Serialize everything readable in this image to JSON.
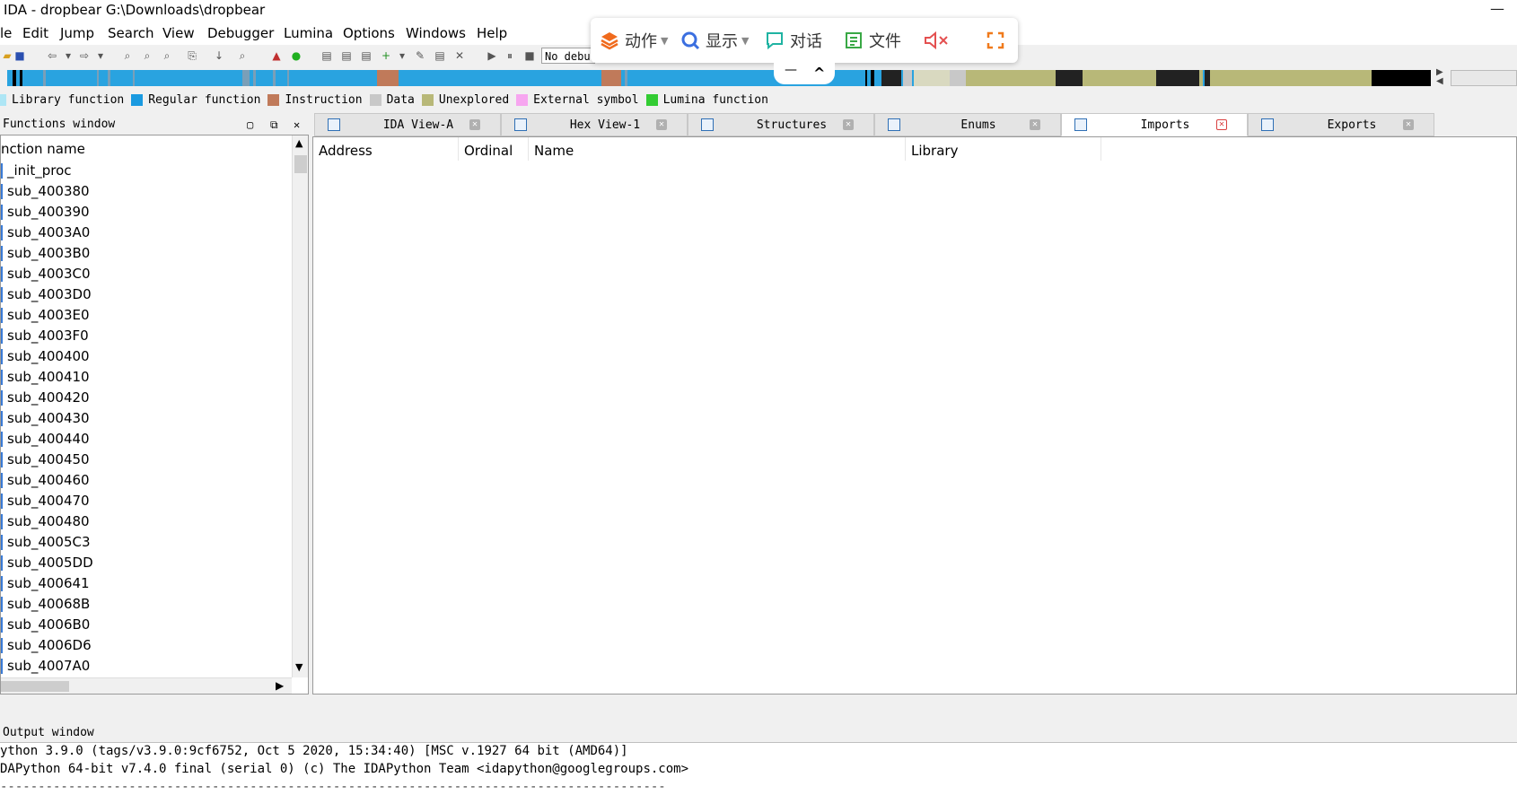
{
  "window": {
    "title": "IDA - dropbear G:\\Downloads\\dropbear",
    "minimize_symbol": "—"
  },
  "menu": [
    "le",
    "Edit",
    "Jump",
    "Search",
    "View",
    "Debugger",
    "Lumina",
    "Options",
    "Windows",
    "Help"
  ],
  "toolbar": {
    "debugger_select_value": "No debu"
  },
  "float_toolbar": {
    "action_label": "动作",
    "display_label": "显示",
    "chat_label": "对话",
    "file_label": "文件",
    "collapse_minus": "—",
    "collapse_up": "^",
    "colors": {
      "action": "#f06a1c",
      "display": "#3b6fe0",
      "chat": "#1fb3a2",
      "file": "#39a845",
      "mute": "#e45050",
      "fullscreen": "#f07a1c"
    }
  },
  "legend": [
    {
      "label": "Library function",
      "color": "#aee6f5"
    },
    {
      "label": "Regular function",
      "color": "#1a9ae0"
    },
    {
      "label": "Instruction",
      "color": "#c07a5a"
    },
    {
      "label": "Data",
      "color": "#c8c8c8"
    },
    {
      "label": "Unexplored",
      "color": "#b8b878"
    },
    {
      "label": "External symbol",
      "color": "#f7a6f0"
    },
    {
      "label": "Lumina function",
      "color": "#33cc33"
    }
  ],
  "functions_window": {
    "title": "Functions window",
    "column": "nction name",
    "items": [
      "_init_proc",
      "sub_400380",
      "sub_400390",
      "sub_4003A0",
      "sub_4003B0",
      "sub_4003C0",
      "sub_4003D0",
      "sub_4003E0",
      "sub_4003F0",
      "sub_400400",
      "sub_400410",
      "sub_400420",
      "sub_400430",
      "sub_400440",
      "sub_400450",
      "sub_400460",
      "sub_400470",
      "sub_400480",
      "sub_4005C3",
      "sub_4005DD",
      "sub_400641",
      "sub_40068B",
      "sub_4006B0",
      "sub_4006D6",
      "sub_4007A0"
    ]
  },
  "tabs": [
    {
      "label": "IDA View-A",
      "active": false
    },
    {
      "label": "Hex View-1",
      "active": false
    },
    {
      "label": "Structures",
      "active": false
    },
    {
      "label": "Enums",
      "active": false
    },
    {
      "label": "Imports",
      "active": true
    },
    {
      "label": "Exports",
      "active": false
    }
  ],
  "imports": {
    "columns": [
      "Address",
      "Ordinal",
      "Name",
      "Library"
    ]
  },
  "output_window": {
    "title": "Output window",
    "lines": [
      "ython 3.9.0 (tags/v3.9.0:9cf6752, Oct  5 2020, 15:34:40) [MSC v.1927 64 bit (AMD64)]",
      "DAPython 64-bit v7.4.0 final (serial 0) (c) The IDAPython Team <idapython@googlegroups.com>",
      "----------------------------------------------------------------------------------------"
    ]
  }
}
